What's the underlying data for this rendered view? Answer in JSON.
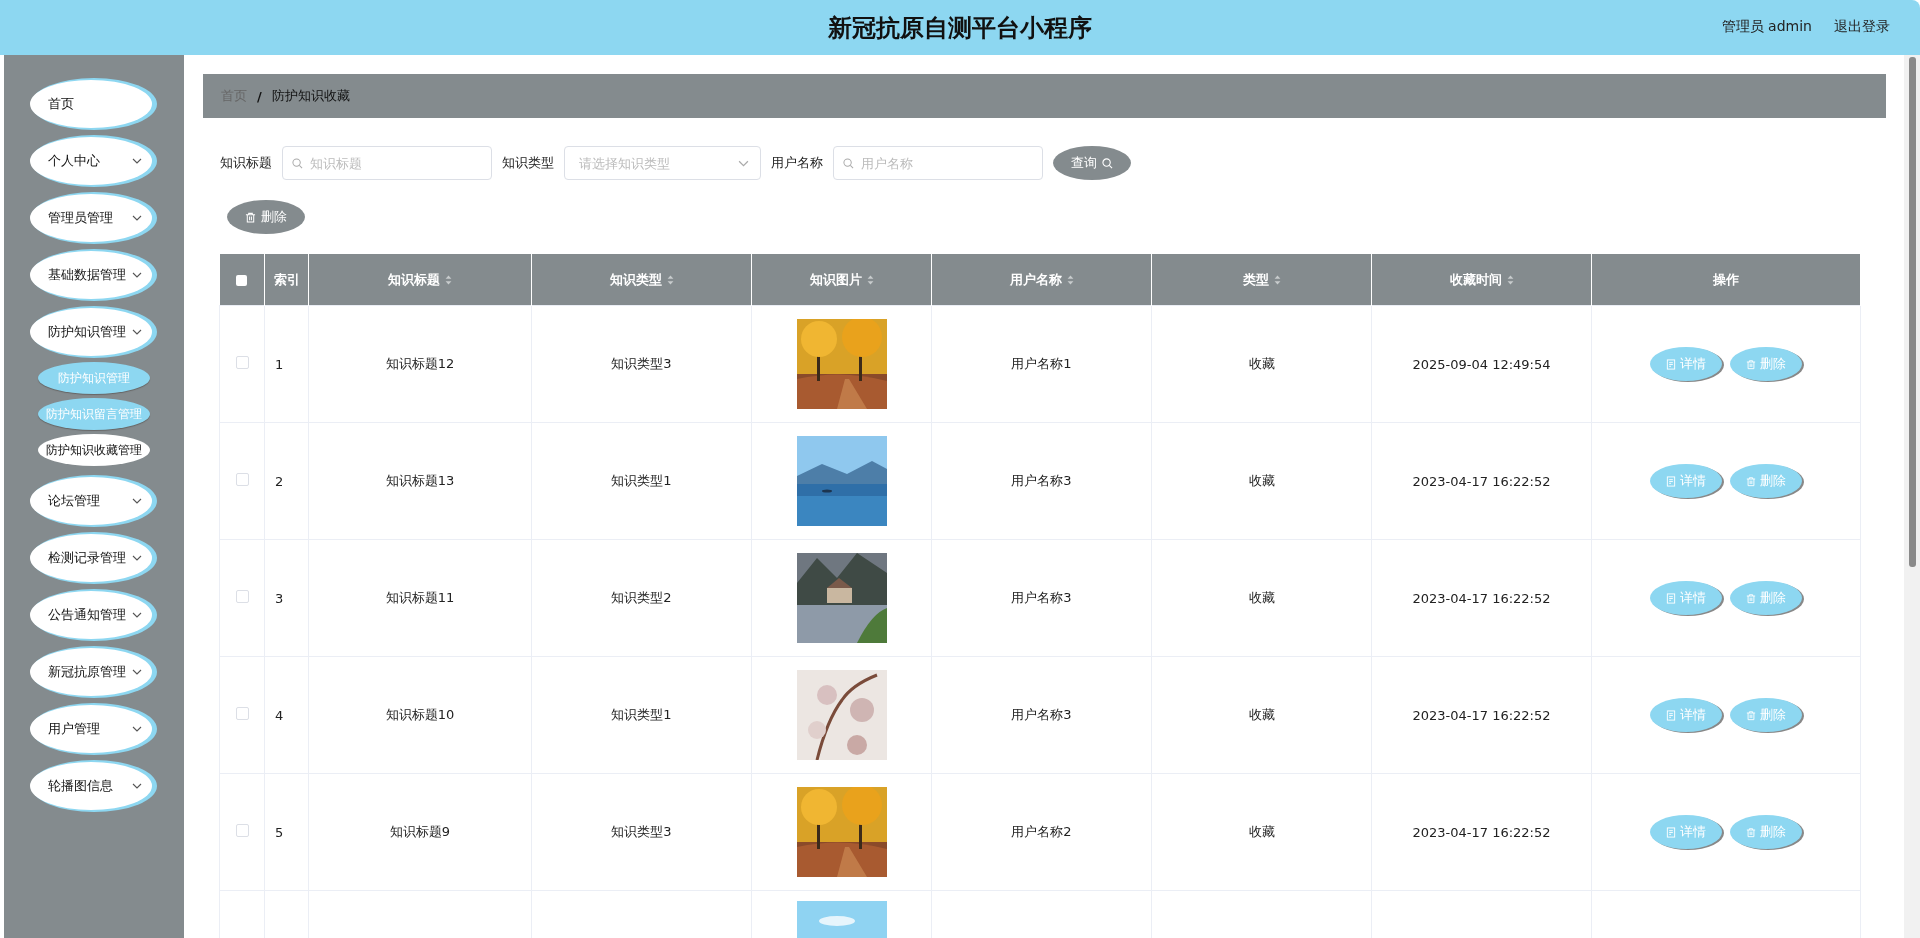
{
  "header": {
    "title": "新冠抗原自测平台小程序",
    "user": "管理员 admin",
    "logout": "退出登录"
  },
  "sidebar": {
    "items": [
      {
        "label": "首页",
        "expandable": false
      },
      {
        "label": "个人中心",
        "expandable": true
      },
      {
        "label": "管理员管理",
        "expandable": true
      },
      {
        "label": "基础数据管理",
        "expandable": true
      },
      {
        "label": "防护知识管理",
        "expandable": true,
        "children": [
          {
            "label": "防护知识管理",
            "highlighted": true
          },
          {
            "label": "防护知识留言管理",
            "highlighted": true
          },
          {
            "label": "防护知识收藏管理",
            "highlighted": false
          }
        ]
      },
      {
        "label": "论坛管理",
        "expandable": true
      },
      {
        "label": "检测记录管理",
        "expandable": true
      },
      {
        "label": "公告通知管理",
        "expandable": true
      },
      {
        "label": "新冠抗原管理",
        "expandable": true
      },
      {
        "label": "用户管理",
        "expandable": true
      },
      {
        "label": "轮播图信息",
        "expandable": true
      }
    ]
  },
  "breadcrumb": [
    "首页",
    "防护知识收藏"
  ],
  "breadcrumb_separator": "/",
  "filters": [
    {
      "label": "知识标题",
      "placeholder": "知识标题",
      "kind": "search"
    },
    {
      "label": "知识类型",
      "placeholder": "请选择知识类型",
      "kind": "select"
    },
    {
      "label": "用户名称",
      "placeholder": "用户名称",
      "kind": "search"
    }
  ],
  "search_button": "查询",
  "delete_button": "删除",
  "table": {
    "all_checked": false,
    "columns": [
      {
        "kind": "checkbox",
        "sortable": false
      },
      {
        "label": "索引",
        "sortable": false
      },
      {
        "label": "知识标题",
        "sortable": true
      },
      {
        "label": "知识类型",
        "sortable": true
      },
      {
        "label": "知识图片",
        "sortable": true
      },
      {
        "label": "用户名称",
        "sortable": true
      },
      {
        "label": "类型",
        "sortable": true
      },
      {
        "label": "收藏时间",
        "sortable": true
      },
      {
        "label": "操作",
        "sortable": false
      }
    ],
    "rows": [
      {
        "checked": false,
        "index": "1",
        "title": "知识标题12",
        "type": "知识类型3",
        "image": {
          "kind": "picture"
        },
        "user": "用户名称1",
        "category": "收藏",
        "time": "2025-09-04 12:49:54",
        "actions": [
          "详情",
          "删除"
        ]
      },
      {
        "checked": false,
        "index": "2",
        "title": "知识标题13",
        "type": "知识类型1",
        "image": {
          "kind": "picture"
        },
        "user": "用户名称3",
        "category": "收藏",
        "time": "2023-04-17 16:22:52",
        "actions": [
          "详情",
          "删除"
        ]
      },
      {
        "checked": false,
        "index": "3",
        "title": "知识标题11",
        "type": "知识类型2",
        "image": {
          "kind": "picture"
        },
        "user": "用户名称3",
        "category": "收藏",
        "time": "2023-04-17 16:22:52",
        "actions": [
          "详情",
          "删除"
        ]
      },
      {
        "checked": false,
        "index": "4",
        "title": "知识标题10",
        "type": "知识类型1",
        "image": {
          "kind": "picture"
        },
        "user": "用户名称3",
        "category": "收藏",
        "time": "2023-04-17 16:22:52",
        "actions": [
          "详情",
          "删除"
        ]
      },
      {
        "checked": false,
        "index": "5",
        "title": "知识标题9",
        "type": "知识类型3",
        "image": {
          "kind": "picture"
        },
        "user": "用户名称2",
        "category": "收藏",
        "time": "2023-04-17 16:22:52",
        "actions": [
          "详情",
          "删除"
        ]
      }
    ]
  }
}
